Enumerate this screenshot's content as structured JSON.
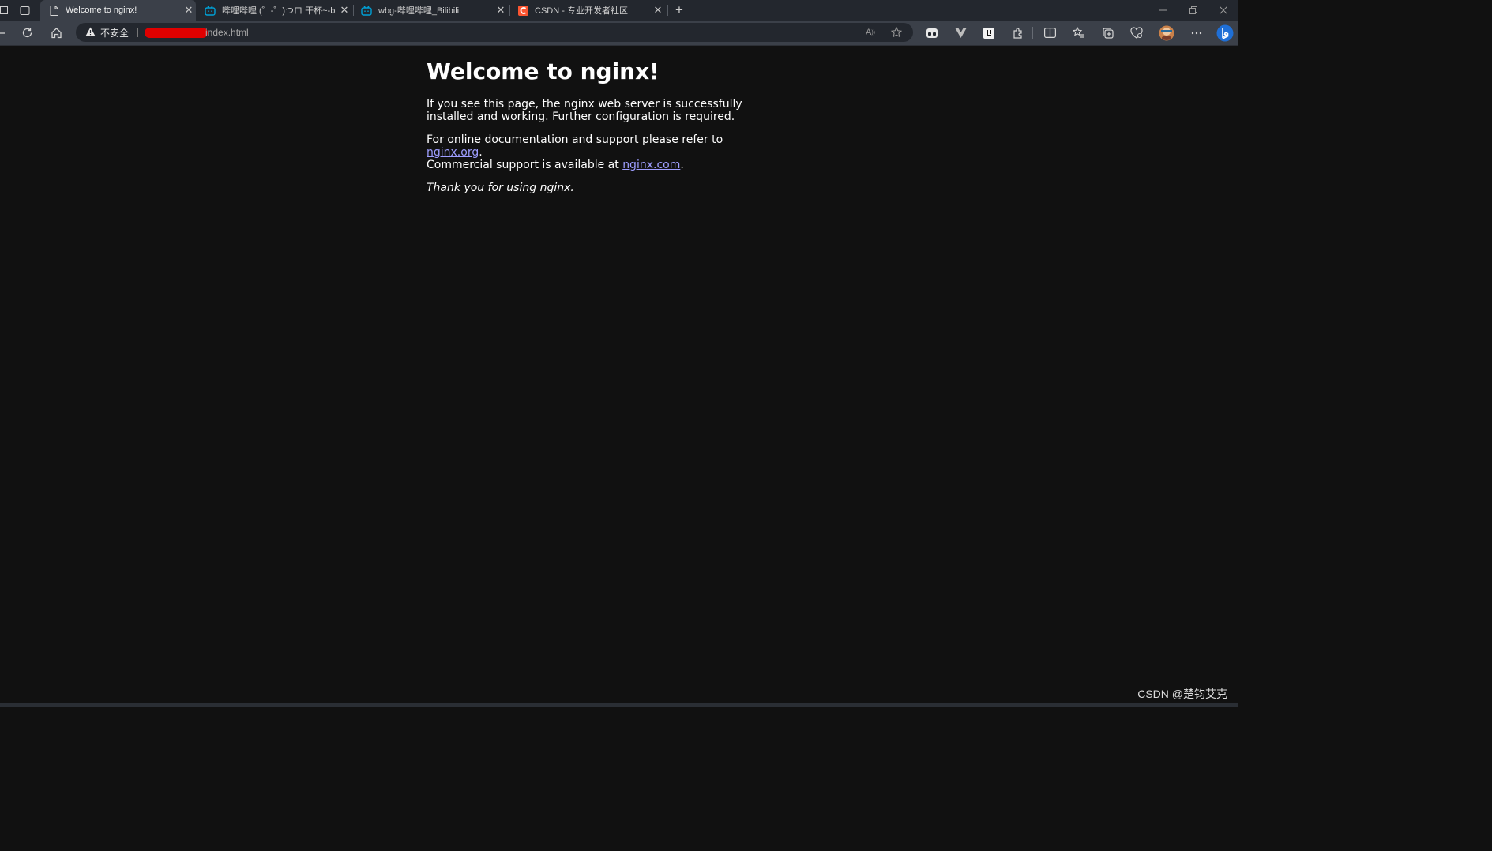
{
  "tabs": [
    {
      "title": "Welcome to nginx!",
      "active": true,
      "favicon": "page-icon"
    },
    {
      "title": "哔哩哔哩 (゜-゜)つロ 干杯~-bilibili",
      "active": false,
      "favicon": "bilibili-icon"
    },
    {
      "title": "wbg-哔哩哔哩_Bilibili",
      "active": false,
      "favicon": "bilibili-icon"
    },
    {
      "title": "CSDN - 专业开发者社区",
      "active": false,
      "favicon": "csdn-icon"
    }
  ],
  "address": {
    "security_label": "不安全",
    "url_visible": "index.html"
  },
  "page": {
    "heading": "Welcome to nginx!",
    "p1": "If you see this page, the nginx web server is successfully installed and working. Further configuration is required.",
    "p2_before": "For online documentation and support please refer to ",
    "p2_link": "nginx.org",
    "p2_mid": ".",
    "p2_line2": "Commercial support is available at ",
    "p2_link2": "nginx.com",
    "p2_end": ".",
    "thanks": "Thank you for using nginx."
  },
  "watermark": "CSDN @楚钧艾克",
  "colors": {
    "page_bg": "#111111",
    "link": "#9e9eff",
    "tab_active": "#3b4049",
    "tabstrip": "#23272e",
    "bilibili": "#00a1d6",
    "csdn": "#fc5531"
  }
}
